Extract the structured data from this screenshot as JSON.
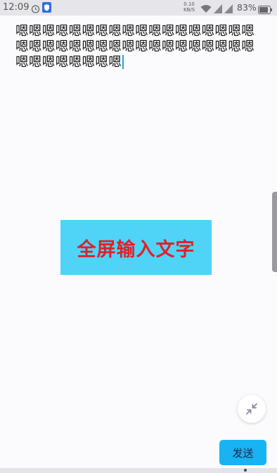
{
  "status_bar": {
    "time": "12:09",
    "net_speed_value": "0.10",
    "net_speed_unit": "KB/S",
    "battery_percent": "83%",
    "icons": [
      "alarm-icon",
      "shield-icon",
      "wifi-icon",
      "signal-icon",
      "signal-icon",
      "battery-icon"
    ]
  },
  "editor": {
    "text": "嗯嗯嗯嗯嗯嗯嗯嗯嗯嗯嗯嗯嗯嗯嗯嗯嗯嗯嗯嗯嗯嗯嗯嗯嗯嗯嗯嗯嗯嗯嗯嗯嗯嗯嗯嗯嗯嗯嗯嗯嗯嗯嗯嗯"
  },
  "banner": {
    "text": "全屏输入文字"
  },
  "actions": {
    "collapse_icon": "collapse-arrows-icon",
    "send_label": "发送"
  },
  "colors": {
    "banner_bg": "#4fd4f7",
    "banner_text": "#e0202a",
    "send_bg": "#17b3f3",
    "caret": "#1aa7e8"
  }
}
